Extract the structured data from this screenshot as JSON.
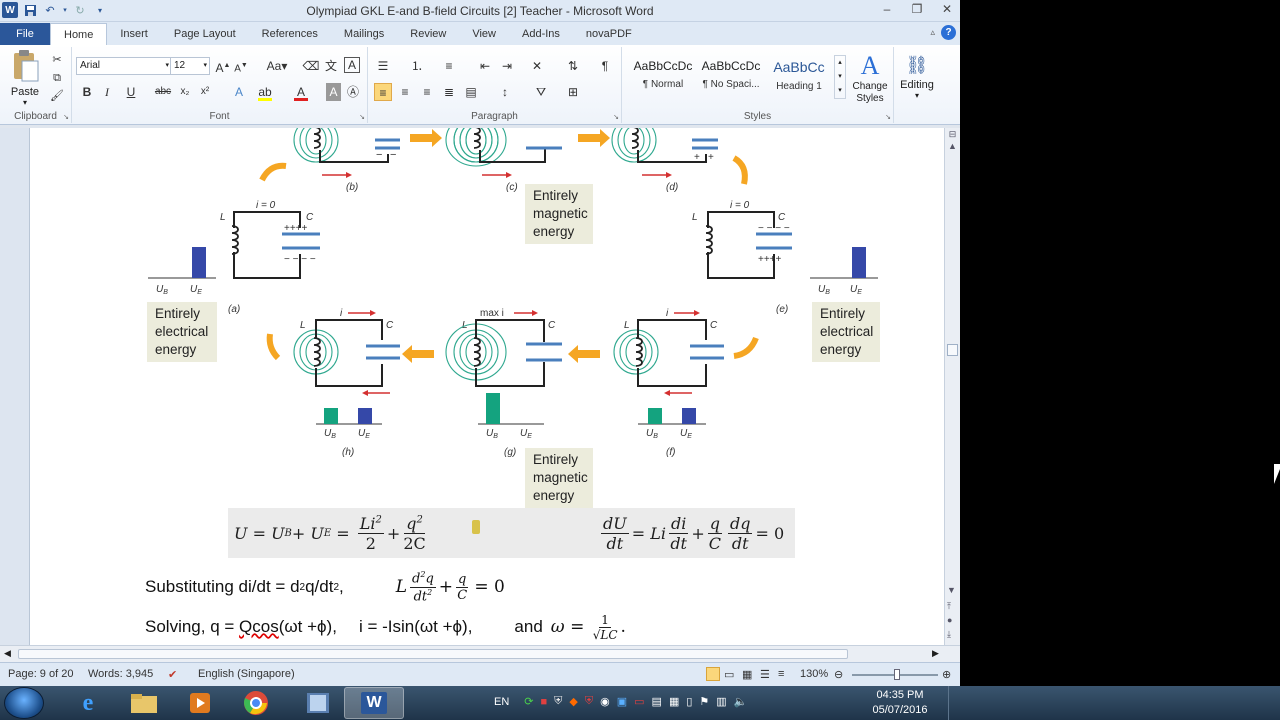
{
  "window": {
    "title": "Olympiad GKL E-and B-field Circuits [2] Teacher - Microsoft Word",
    "app_icon": "word-icon"
  },
  "tabs": [
    "File",
    "Home",
    "Insert",
    "Page Layout",
    "References",
    "Mailings",
    "Review",
    "View",
    "Add-Ins",
    "novaPDF"
  ],
  "active_tab": "Home",
  "ribbon": {
    "clipboard": {
      "paste": "Paste",
      "label": "Clipboard"
    },
    "font": {
      "name": "Arial",
      "size": "12",
      "label": "Font"
    },
    "paragraph": {
      "label": "Paragraph"
    },
    "styles": {
      "label": "Styles",
      "items": [
        {
          "preview": "AaBbCcDc",
          "name": "¶ Normal"
        },
        {
          "preview": "AaBbCcDc",
          "name": "¶ No Spaci..."
        },
        {
          "preview": "AaBbCc",
          "name": "Heading 1"
        }
      ],
      "change_styles": "Change Styles"
    },
    "editing": {
      "label": "Editing"
    }
  },
  "document": {
    "figure_labels": {
      "a": "(a)",
      "b": "(b)",
      "c": "(c)",
      "d": "(d)",
      "e": "(e)",
      "f": "(f)",
      "g": "(g)",
      "h": "(h)",
      "i0": "i = 0",
      "i": "i",
      "maxi": "max i",
      "L": "L",
      "C": "C",
      "UB": "U",
      "UE": "U",
      "sub_b": "B",
      "sub_e": "E"
    },
    "energy_boxes": {
      "magnetic": "Entirely magnetic energy",
      "electrical": "Entirely electrical energy"
    },
    "eq1": {
      "lhs": "U = U",
      "b": "B",
      "mid": " + U",
      "e": "E",
      "eq": " = ",
      "f1n": "Li",
      "f1sup": "2",
      "f1d": "2",
      "plus": "+",
      "f2n": "q",
      "f2sup": "2",
      "f2d": "2C"
    },
    "eq2": {
      "f1n": "dU",
      "f1d": "dt",
      "eq": "= Li",
      "f2n": "di",
      "f2d": "dt",
      "plus": "+",
      "f3n": "q",
      "f3d": "C",
      "f4n": "dq",
      "f4d": "dt",
      "end": "= 0"
    },
    "line1": {
      "text": "Substituting di/dt = d",
      "sup1": "2",
      "mid": "q/dt",
      "sup2": "2",
      "end": ",",
      "L": "L",
      "fn": "d",
      "fnsup": "2",
      "fnq": "q",
      "fd": "dt",
      "fdsup": "2",
      "plus": "+",
      "qn": "q",
      "qd": "C",
      "eq": "= 0"
    },
    "line2": {
      "solving": "Solving, q = ",
      "qcos": "Qcos",
      "phase": "(ωt +ϕ),",
      "i": "i = -Isin(ωt +ϕ),",
      "and": "and",
      "omega": "ω = ",
      "one": "1",
      "sqrt": "√LC",
      "dot": "."
    }
  },
  "status": {
    "page": "Page: 9 of 20",
    "words": "Words: 3,945",
    "language": "English (Singapore)",
    "zoom": "130%"
  },
  "taskbar": {
    "lang": "EN",
    "time": "04:35 PM",
    "date": "05/07/2016",
    "apps": [
      "start-button",
      "internet-explorer-icon",
      "file-explorer-icon",
      "media-player-icon",
      "chrome-icon",
      "video-icon",
      "word-icon"
    ]
  },
  "colors": {
    "word_blue": "#2b579a",
    "uB_bar": "#14a37f",
    "uE_bar": "#3548a8",
    "field_line": "#2fa88f",
    "arrow_orange": "#f5a623",
    "current_red": "#d43030",
    "plate_blue": "#4a7fbd"
  }
}
